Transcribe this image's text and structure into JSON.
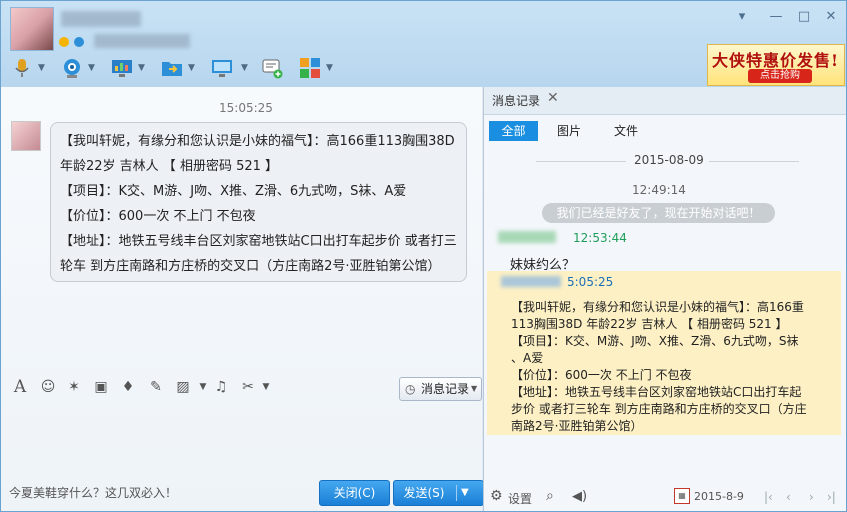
{
  "toolbar_icons": [
    "microphone-icon",
    "video-camera-icon",
    "share-screen-icon",
    "send-file-icon",
    "remote-desktop-icon",
    "message-add-icon",
    "apps-icon"
  ],
  "ad": {
    "headline": "大侠特惠价发售!",
    "cta": "点击抢购"
  },
  "chat": {
    "time": "15:05:25",
    "lines": [
      "【我叫轩妮，有缘分和您认识是小妹的福气】：高166重113胸围38D",
      "年龄22岁  吉林人    【 相册密码 521 】",
      "【项目】：K交、M游、J吻、X推、Z滑、6九式吻，S袜、A爱",
      "【价位】：600一次   不上门   不包夜",
      "【地址】：地铁五号线丰台区刘家窑地铁站C口出打车起步价 或者打三",
      "轮车 到方庄南路和方庄桥的交叉口（方庄南路2号·亚胜铂第公馆）"
    ]
  },
  "input_toolbar": {
    "history_label": "消息记录"
  },
  "ticker": "今夏美鞋穿什么？这几双必入！",
  "buttons": {
    "close": "关闭(C)",
    "send": "发送(S)"
  },
  "history": {
    "tab": "消息记录",
    "filters": [
      "全部",
      "图片",
      "文件"
    ],
    "active_filter": "全部",
    "date": "2015-08-09",
    "time1": "12:49:14",
    "system_msg": "我们已经是好友了，现在开始对话吧！",
    "time2": "12:53:44",
    "msg1": "妹妹约么？",
    "time3": "5:05:25",
    "highlight_lines": [
      "【我叫轩妮，有缘分和您认识是小妹的福气】：高166重",
      "113胸围38D  年龄22岁  吉林人    【 相册密码  521 】",
      "【项目】：K交、M游、J吻、X推、Z滑、6九式吻，S袜",
      "、A爱",
      "【价位】：600一次   不上门   不包夜",
      "【地址】：地铁五号线丰台区刘家窑地铁站C口出打车起",
      "步价 或者打三轮车 到方庄南路和方庄桥的交叉口（方庄",
      "南路2号·亚胜铂第公馆）"
    ],
    "settings": "设置",
    "footer_date": "2015-8-9"
  },
  "colors": {
    "accent": "#1a7fd6",
    "highlight": "#fdf0c4",
    "time_green": "#1e9e5a"
  }
}
